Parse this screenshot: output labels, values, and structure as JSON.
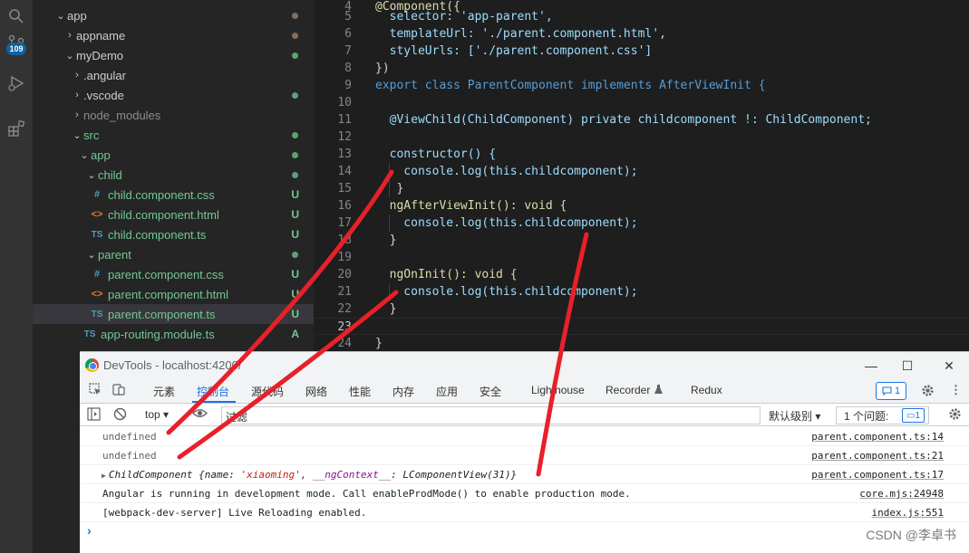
{
  "activity": {
    "scm_badge": "109"
  },
  "explorer": {
    "rows": [
      {
        "label": "app",
        "status": ""
      },
      {
        "label": "appname",
        "status": ""
      },
      {
        "label": "myDemo",
        "status": ""
      },
      {
        "label": ".angular",
        "status": ""
      },
      {
        "label": ".vscode",
        "status": ""
      },
      {
        "label": "node_modules",
        "status": ""
      },
      {
        "label": "src",
        "status": ""
      },
      {
        "label": "app",
        "status": ""
      },
      {
        "label": "child",
        "status": ""
      },
      {
        "label": "child.component.css",
        "status": "U"
      },
      {
        "label": "child.component.html",
        "status": "U"
      },
      {
        "label": "child.component.ts",
        "status": "U"
      },
      {
        "label": "parent",
        "status": ""
      },
      {
        "label": "parent.component.css",
        "status": "U"
      },
      {
        "label": "parent.component.html",
        "status": "U"
      },
      {
        "label": "parent.component.ts",
        "status": "U"
      },
      {
        "label": "app-routing.module.ts",
        "status": "A"
      }
    ],
    "icons": {
      "css": "#",
      "html": "<>",
      "ts": "TS"
    }
  },
  "editor": {
    "lines": [
      {
        "num": "4",
        "text": "@Component({"
      },
      {
        "num": "5",
        "text": "  selector: 'app-parent',"
      },
      {
        "num": "6",
        "text": "  templateUrl: './parent.component.html',"
      },
      {
        "num": "7",
        "text": "  styleUrls: ['./parent.component.css']"
      },
      {
        "num": "8",
        "text": "})"
      },
      {
        "num": "9",
        "text": "export class ParentComponent implements AfterViewInit {"
      },
      {
        "num": "10",
        "text": ""
      },
      {
        "num": "11",
        "text": "  @ViewChild(ChildComponent) private childcomponent !: ChildComponent;"
      },
      {
        "num": "12",
        "text": ""
      },
      {
        "num": "13",
        "text": "  constructor() {"
      },
      {
        "num": "14",
        "text": "    console.log(this.childcomponent);"
      },
      {
        "num": "15",
        "text": "   }"
      },
      {
        "num": "16",
        "text": "  ngAfterViewInit(): void {"
      },
      {
        "num": "17",
        "text": "    console.log(this.childcomponent);"
      },
      {
        "num": "18",
        "text": "  }"
      },
      {
        "num": "19",
        "text": ""
      },
      {
        "num": "20",
        "text": "  ngOnInit(): void {"
      },
      {
        "num": "21",
        "text": "    console.log(this.childcomponent);"
      },
      {
        "num": "22",
        "text": "  }"
      },
      {
        "num": "23",
        "text": ""
      },
      {
        "num": "24",
        "text": "}"
      }
    ]
  },
  "devtools": {
    "title": "DevTools - localhost:4200/",
    "window_controls": {
      "minimize": "—",
      "maximize": "☐",
      "close": "✕"
    },
    "tabs": [
      "元素",
      "控制台",
      "源代码",
      "网络",
      "性能",
      "内存",
      "应用",
      "安全",
      "Lighthouse",
      "Recorder",
      "Redux"
    ],
    "active_tab": "控制台",
    "message_count": "1",
    "toolbar": {
      "context": "top",
      "filter_placeholder": "过滤",
      "levels": "默认级别",
      "issues_label": "1 个问题:",
      "issues_count": "1"
    },
    "console": [
      {
        "msg": "undefined",
        "src": "parent.component.ts:14"
      },
      {
        "msg": "undefined",
        "src": "parent.component.ts:21"
      },
      {
        "msg": "ChildComponent {name: 'xiaoming', __ngContext__: LComponentView(31)}",
        "src": "parent.component.ts:17"
      },
      {
        "msg": "Angular is running in development mode. Call enableProdMode() to enable production mode.",
        "src": "core.mjs:24948"
      },
      {
        "msg": "[webpack-dev-server] Live Reloading enabled.",
        "src": "index.js:551"
      }
    ],
    "obj_parts": {
      "cls": "ChildComponent",
      "open": " {name: ",
      "name_val": "'xiaoming'",
      "sep": ", ",
      "ctx_key": "__ngContext__",
      "ctx_val": ": LComponentView(31)}"
    }
  },
  "watermark": "CSDN @李卓书",
  "colors": {
    "annotation": "#e8202a",
    "accent": "#1a73e8"
  }
}
